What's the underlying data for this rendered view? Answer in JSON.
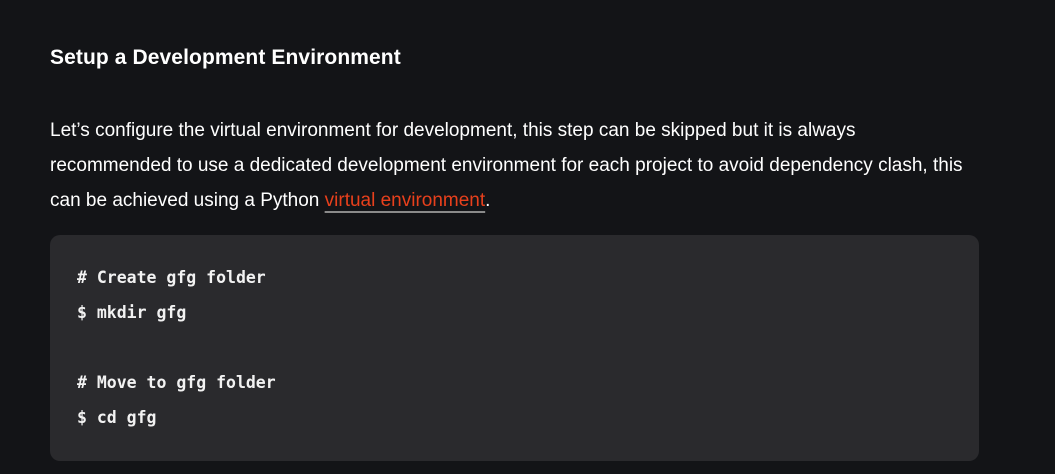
{
  "heading": "Setup a Development Environment",
  "paragraph": {
    "text_before": "Let’s configure the virtual environment for development, this step can be skipped but it is always recommended to use a dedicated development environment for each project to avoid dependency clash, this can be achieved using a Python ",
    "link_text": "virtual environment",
    "text_after": "."
  },
  "code_lines": [
    "# Create gfg folder",
    "$ mkdir gfg",
    "",
    "# Move to gfg folder",
    "$ cd gfg"
  ],
  "colors": {
    "background": "#131417",
    "code_bg": "#2a2a2d",
    "link": "#e8401c"
  }
}
